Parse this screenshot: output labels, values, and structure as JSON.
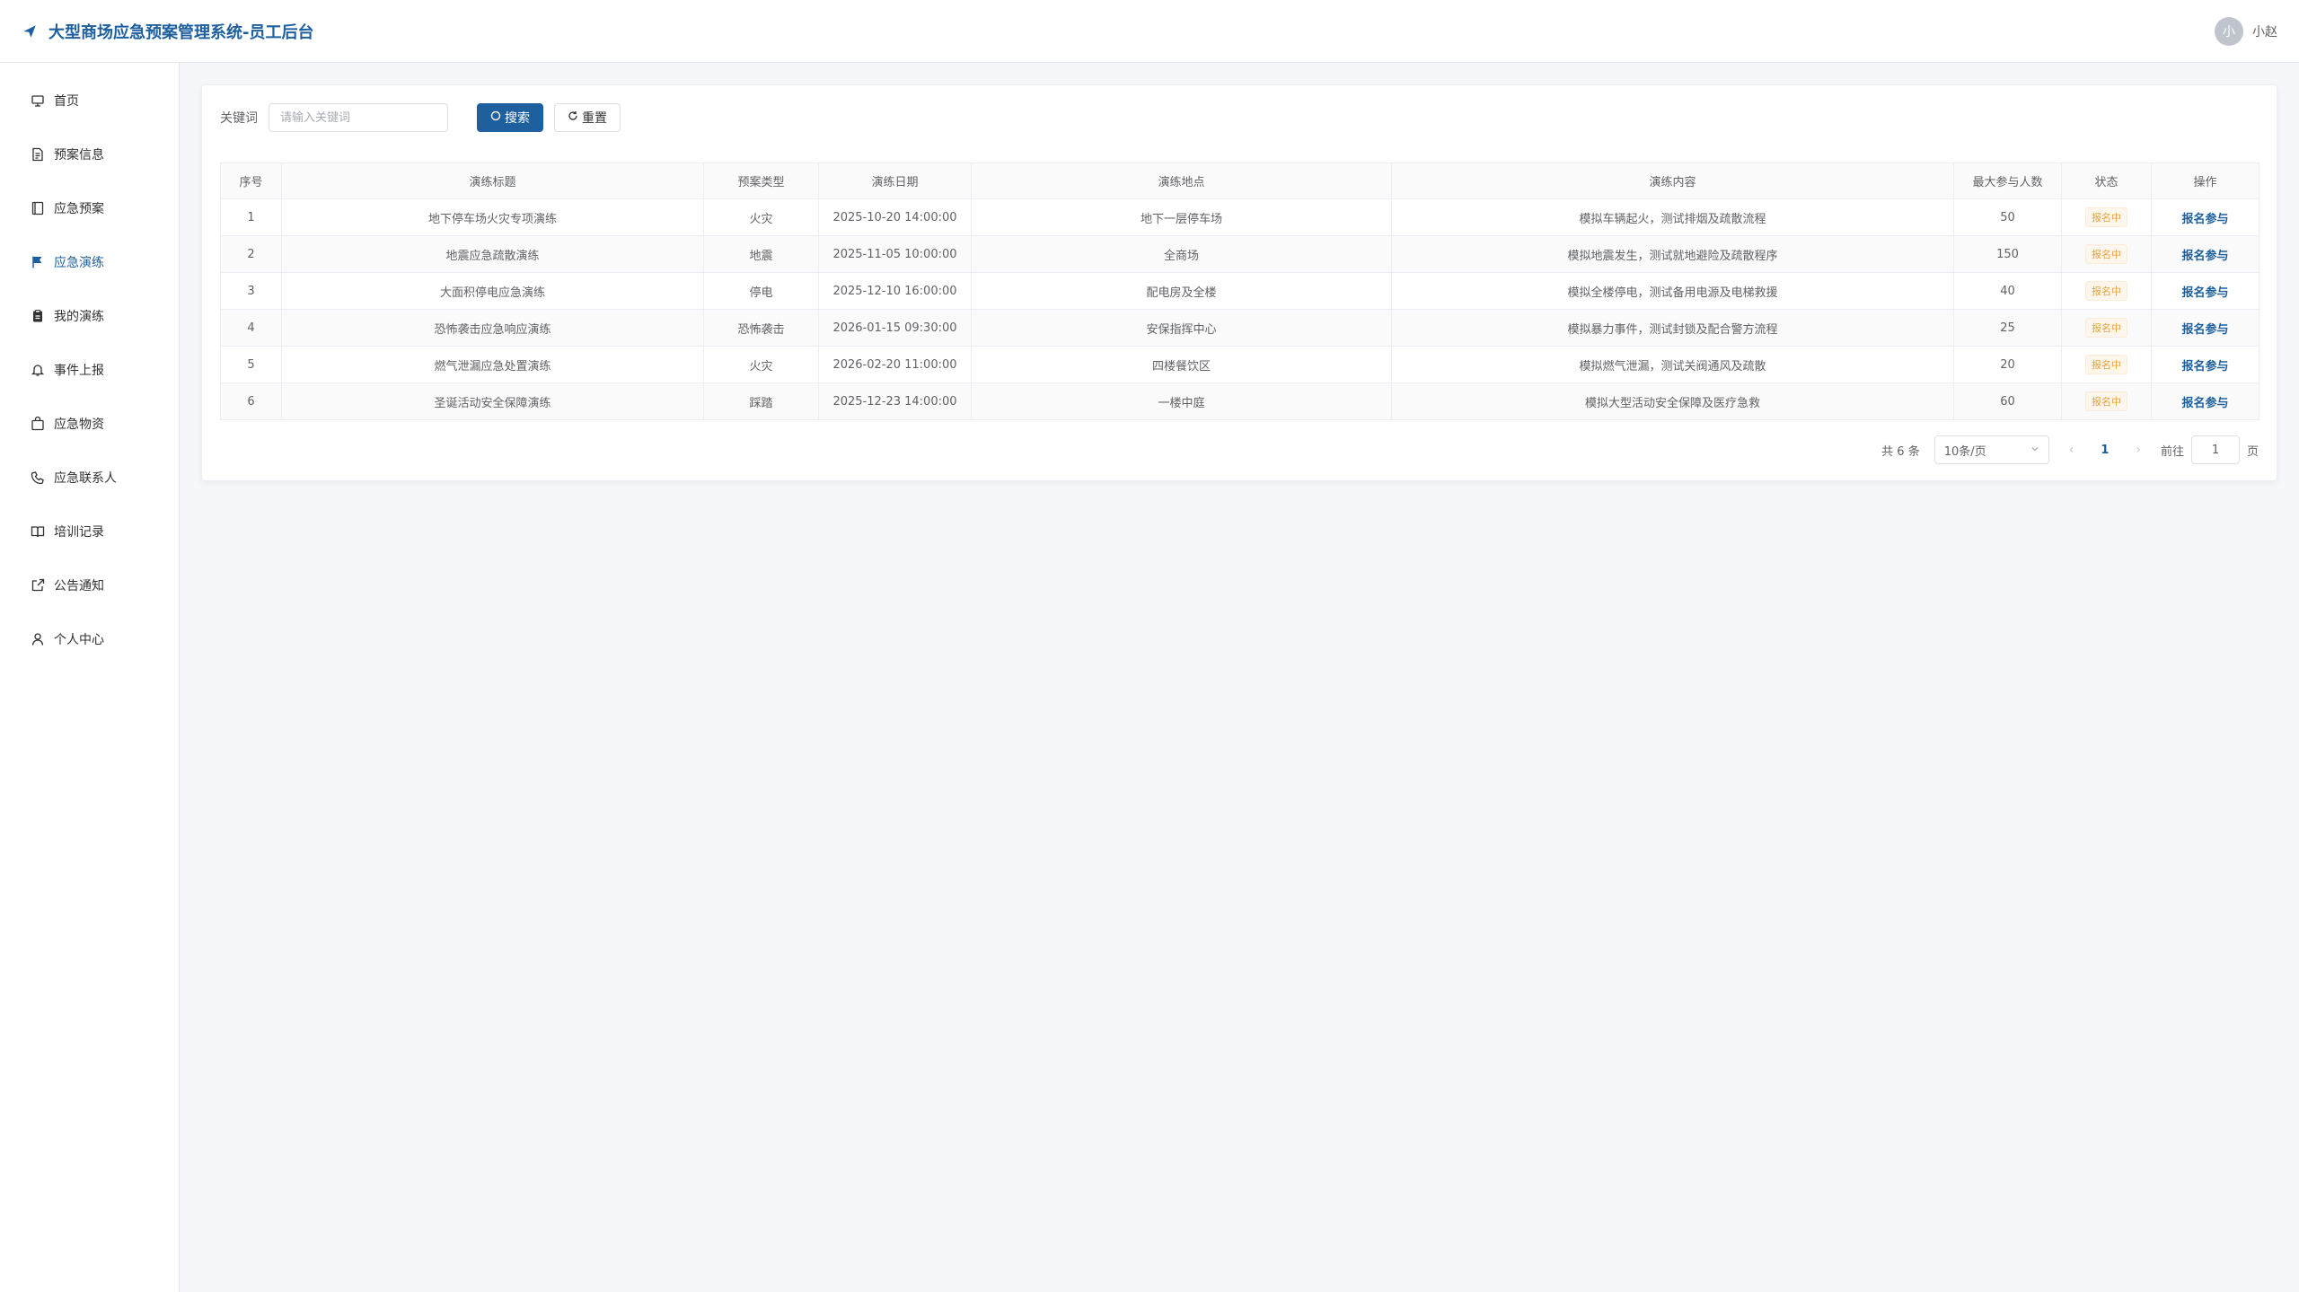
{
  "header": {
    "title": "大型商场应急预案管理系统-员工后台",
    "avatar_text": "小",
    "username": "小赵"
  },
  "colors": {
    "accent": "#1e5f9e",
    "warning": "#e6a23c",
    "border": "#ebeef5"
  },
  "sidebar": {
    "items": [
      {
        "label": "首页",
        "icon": "home-icon",
        "active": false
      },
      {
        "label": "预案信息",
        "icon": "document-icon",
        "active": false
      },
      {
        "label": "应急预案",
        "icon": "notebook-icon",
        "active": false
      },
      {
        "label": "应急演练",
        "icon": "flag-icon",
        "active": true
      },
      {
        "label": "我的演练",
        "icon": "clipboard-icon",
        "active": false
      },
      {
        "label": "事件上报",
        "icon": "bell-icon",
        "active": false
      },
      {
        "label": "应急物资",
        "icon": "box-icon",
        "active": false
      },
      {
        "label": "应急联系人",
        "icon": "phone-icon",
        "active": false
      },
      {
        "label": "培训记录",
        "icon": "book-icon",
        "active": false
      },
      {
        "label": "公告通知",
        "icon": "share-icon",
        "active": false
      },
      {
        "label": "个人中心",
        "icon": "user-icon",
        "active": false
      }
    ]
  },
  "search": {
    "label": "关键词",
    "placeholder": "请输入关键词",
    "value": "",
    "search_button": "搜索",
    "reset_button": "重置"
  },
  "table": {
    "columns": [
      "序号",
      "演练标题",
      "预案类型",
      "演练日期",
      "演练地点",
      "演练内容",
      "最大参与人数",
      "状态",
      "操作"
    ],
    "rows": [
      {
        "no": "1",
        "title": "地下停车场火灾专项演练",
        "type": "火灾",
        "date": "2025-10-20 14:00:00",
        "location": "地下一层停车场",
        "content": "模拟车辆起火，测试排烟及疏散流程",
        "max": "50",
        "status": "报名中",
        "action": "报名参与"
      },
      {
        "no": "2",
        "title": "地震应急疏散演练",
        "type": "地震",
        "date": "2025-11-05 10:00:00",
        "location": "全商场",
        "content": "模拟地震发生，测试就地避险及疏散程序",
        "max": "150",
        "status": "报名中",
        "action": "报名参与"
      },
      {
        "no": "3",
        "title": "大面积停电应急演练",
        "type": "停电",
        "date": "2025-12-10 16:00:00",
        "location": "配电房及全楼",
        "content": "模拟全楼停电，测试备用电源及电梯救援",
        "max": "40",
        "status": "报名中",
        "action": "报名参与"
      },
      {
        "no": "4",
        "title": "恐怖袭击应急响应演练",
        "type": "恐怖袭击",
        "date": "2026-01-15 09:30:00",
        "location": "安保指挥中心",
        "content": "模拟暴力事件，测试封锁及配合警方流程",
        "max": "25",
        "status": "报名中",
        "action": "报名参与"
      },
      {
        "no": "5",
        "title": "燃气泄漏应急处置演练",
        "type": "火灾",
        "date": "2026-02-20 11:00:00",
        "location": "四楼餐饮区",
        "content": "模拟燃气泄漏，测试关阀通风及疏散",
        "max": "20",
        "status": "报名中",
        "action": "报名参与"
      },
      {
        "no": "6",
        "title": "圣诞活动安全保障演练",
        "type": "踩踏",
        "date": "2025-12-23 14:00:00",
        "location": "一楼中庭",
        "content": "模拟大型活动安全保障及医疗急救",
        "max": "60",
        "status": "报名中",
        "action": "报名参与"
      }
    ]
  },
  "pagination": {
    "total": "共 6 条",
    "page_size": "10条/页",
    "current_page": "1",
    "goto_label": "前往",
    "goto_value": "1",
    "page_suffix": "页"
  }
}
